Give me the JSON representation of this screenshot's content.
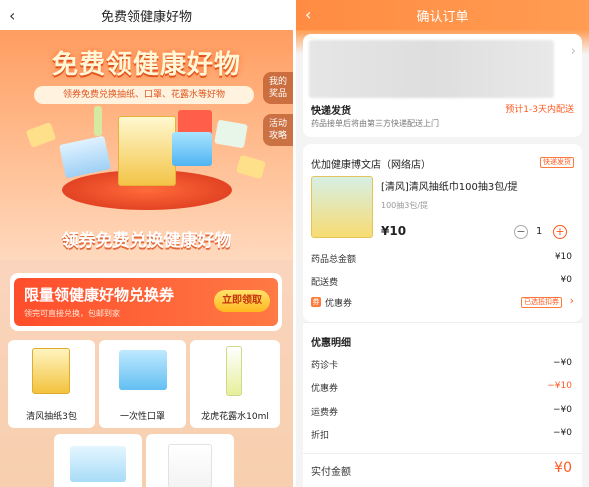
{
  "left": {
    "nav": {
      "back_icon": "chevron-left-icon",
      "title": "免费领健康好物"
    },
    "hero": {
      "title": "免费领健康好物",
      "subtitle": "领券免费兑换抽纸、口罩、花露水等好物",
      "side_tabs": [
        "我的奖品",
        "活动攻略"
      ],
      "banner2": "领券免费兑换健康好物"
    },
    "coupon": {
      "title": "限量领健康好物兑换券",
      "subtitle": "领完可直接兑换，包邮到家",
      "button": "立即领取"
    },
    "products": [
      {
        "name": "清风抽纸3包"
      },
      {
        "name": "一次性口罩"
      },
      {
        "name": "龙虎花露水10ml"
      }
    ]
  },
  "right": {
    "nav": {
      "back_icon": "chevron-left-icon",
      "title": "确认订单"
    },
    "shipping": {
      "label": "快递发货",
      "eta": "预计1-3天内配送",
      "note": "药品接单后将由第三方快递配送上门"
    },
    "store": {
      "name": "优加健康博文店（网络店）",
      "tag": "快递发货"
    },
    "item": {
      "title": "[清风]清风抽纸巾100抽3包/提",
      "spec": "100抽3包/提",
      "price": "¥10",
      "qty": "1"
    },
    "summary": [
      {
        "label": "药品总金额",
        "value": "¥10"
      },
      {
        "label": "配送费",
        "value": "¥0"
      }
    ],
    "discount": {
      "label": "优惠券",
      "tag": "已选抵扣券"
    },
    "detail": {
      "title": "优惠明细",
      "rows": [
        {
          "label": "药诊卡",
          "value": "−¥0",
          "highlight": false
        },
        {
          "label": "优惠券",
          "value": "−¥10",
          "highlight": true
        },
        {
          "label": "运费券",
          "value": "−¥0",
          "highlight": false
        },
        {
          "label": "折扣",
          "value": "−¥0",
          "highlight": false
        }
      ],
      "total_label": "实付金额",
      "total_value": "¥0"
    },
    "colors": {
      "accent": "#ff5a1f",
      "nav": "#ff8c42"
    }
  }
}
